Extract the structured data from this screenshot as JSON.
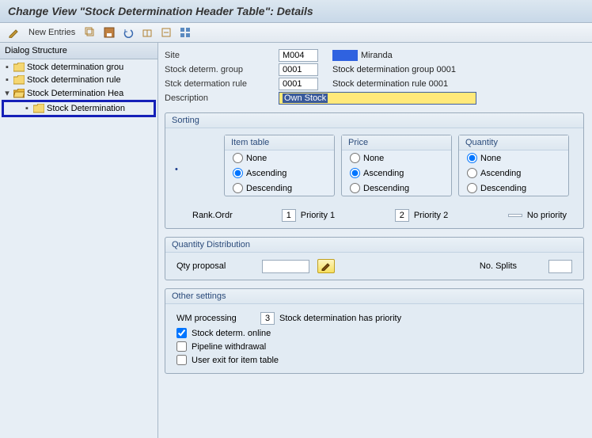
{
  "title": "Change View \"Stock Determination Header Table\": Details",
  "toolbar": {
    "new_entries": "New Entries"
  },
  "sidebar": {
    "header": "Dialog Structure",
    "items": [
      {
        "label": "Stock determination grou"
      },
      {
        "label": "Stock determination rule"
      },
      {
        "label": "Stock Determination Hea"
      },
      {
        "label": "Stock Determination"
      }
    ]
  },
  "fields": {
    "site_label": "Site",
    "site_value": "M004",
    "site_text": "Miranda",
    "group_label": "Stock determ. group",
    "group_value": "0001",
    "group_text": "Stock determination group 0001",
    "rule_label": "Stck determation rule",
    "rule_value": "0001",
    "rule_text": "Stock determination rule 0001",
    "desc_label": "Description",
    "desc_value": "Own Stock"
  },
  "sorting": {
    "title": "Sorting",
    "cols": {
      "item": "Item table",
      "price": "Price",
      "qty": "Quantity"
    },
    "opts": {
      "none": "None",
      "asc": "Ascending",
      "desc": "Descending"
    },
    "rank_label": "Rank.Ordr",
    "rank1_val": "1",
    "rank1_txt": "Priority 1",
    "rank2_val": "2",
    "rank2_txt": "Priority 2",
    "rank3_txt": "No priority"
  },
  "qty_dist": {
    "title": "Quantity Distribution",
    "proposal_label": "Qty proposal",
    "splits_label": "No. Splits"
  },
  "other": {
    "title": "Other settings",
    "wm_label": "WM processing",
    "wm_value": "3",
    "wm_text": "Stock determination has priority",
    "cb1": "Stock determ. online",
    "cb2": "Pipeline withdrawal",
    "cb3": "User exit for item table"
  }
}
